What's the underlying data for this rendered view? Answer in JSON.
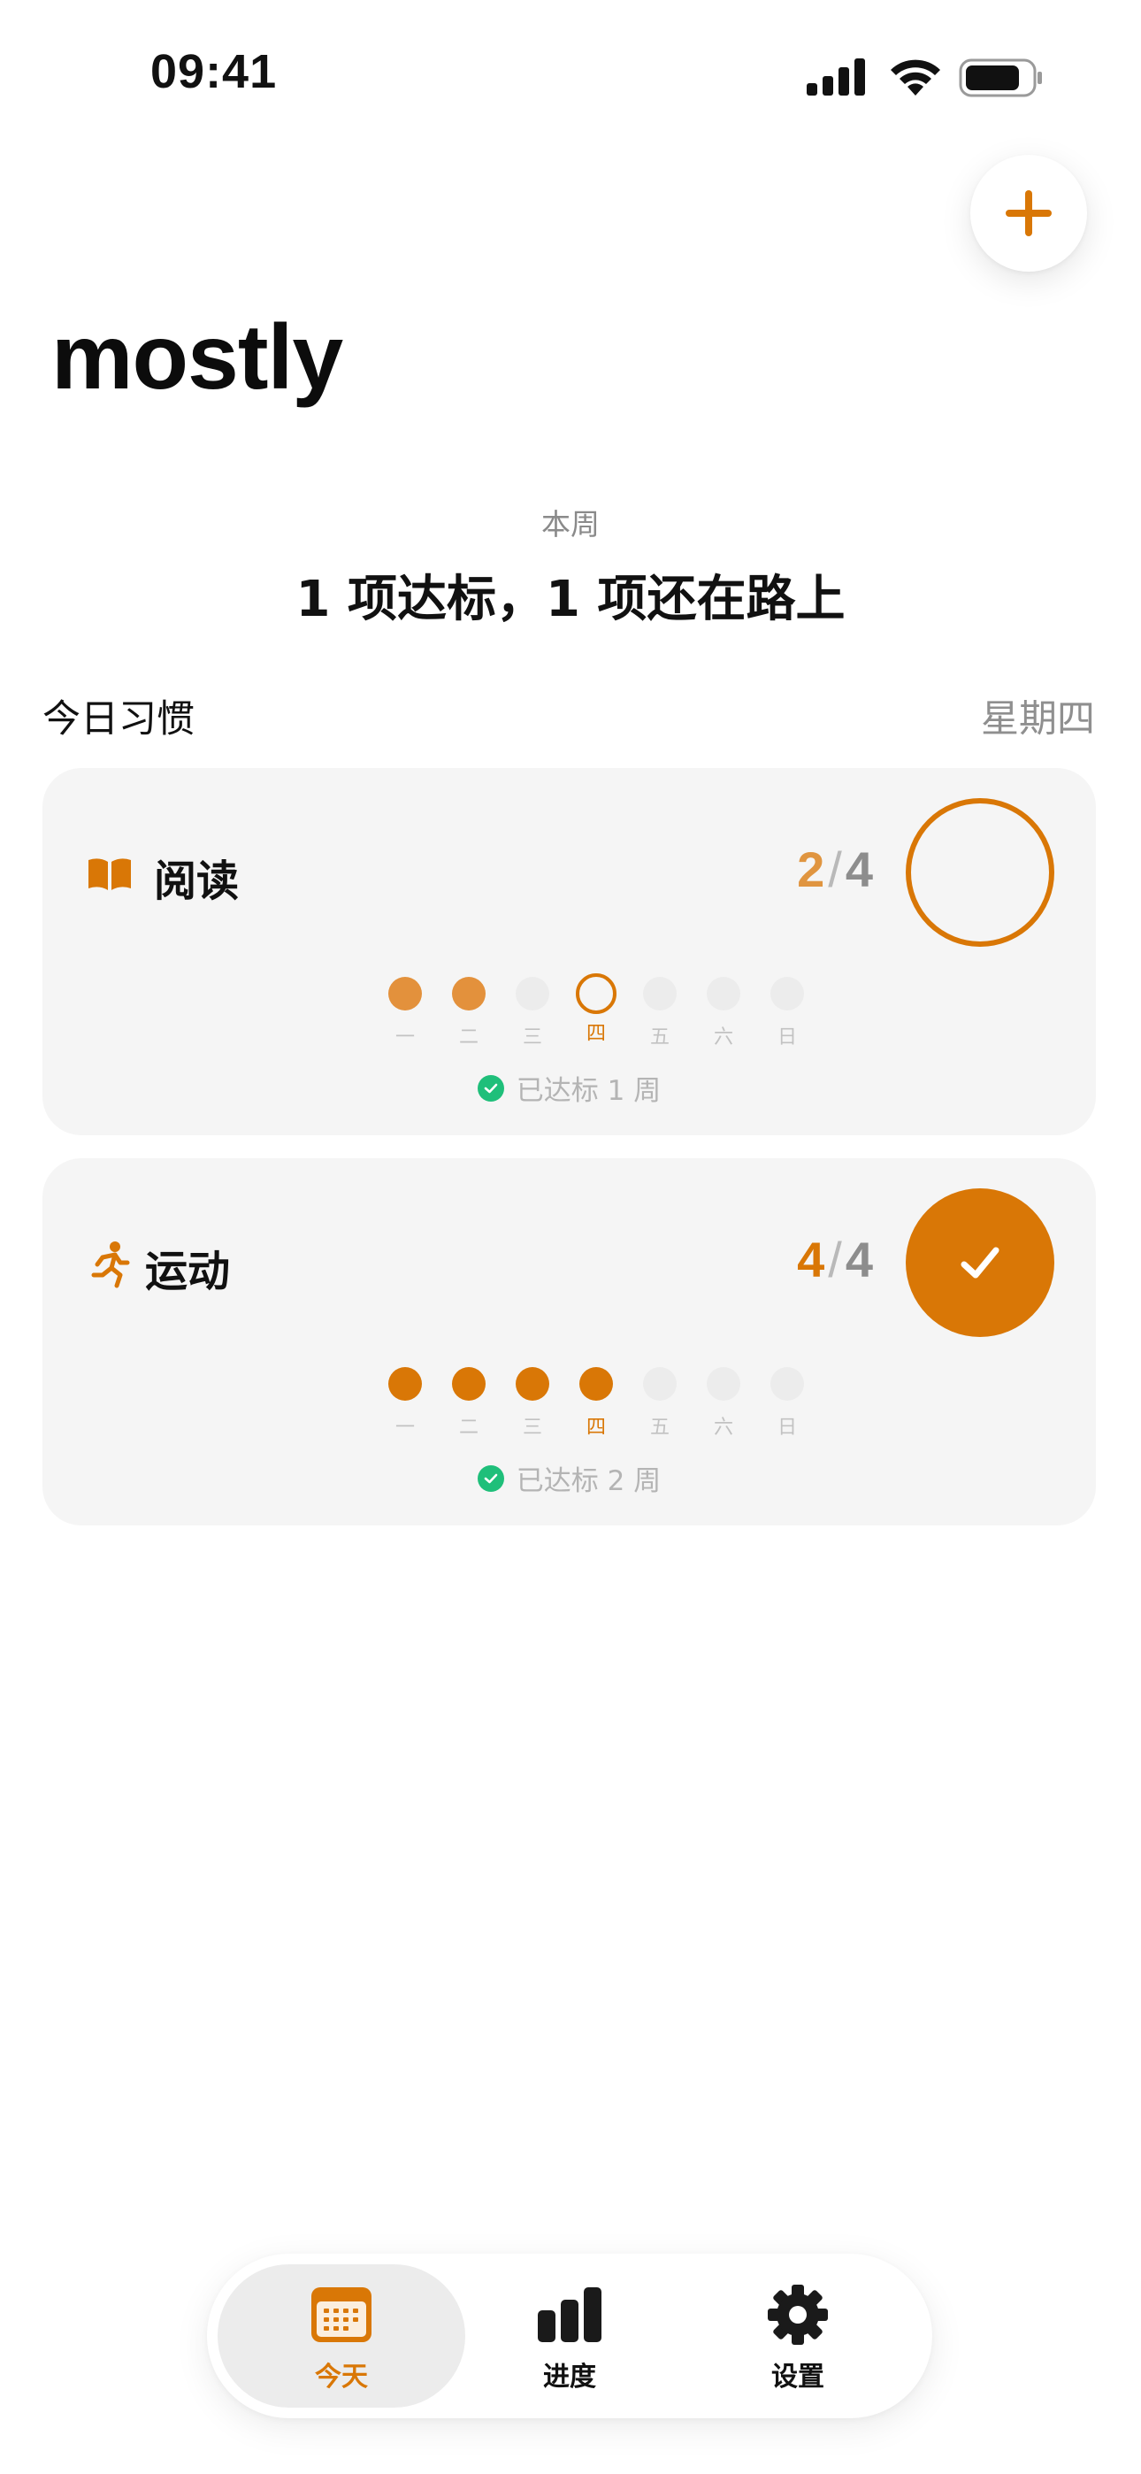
{
  "status_bar": {
    "time": "09:41"
  },
  "header": {
    "app_title": "mostly",
    "add_icon": "plus-icon"
  },
  "summary": {
    "label": "本周",
    "text": "1 项达标，1 项还在路上"
  },
  "today_section": {
    "title": "今日习惯",
    "weekday": "星期四"
  },
  "weekday_labels": [
    "一",
    "二",
    "三",
    "四",
    "五",
    "六",
    "日"
  ],
  "habits": [
    {
      "name": "阅读",
      "icon": "book-icon",
      "done": "2",
      "separator": "/",
      "target": "4",
      "completed_today": false,
      "week_status": [
        "done",
        "done",
        "none",
        "today-pending",
        "none",
        "none",
        "none"
      ],
      "streak_text": "已达标 1 周"
    },
    {
      "name": "运动",
      "icon": "running-icon",
      "done": "4",
      "separator": "/",
      "target": "4",
      "completed_today": true,
      "week_status": [
        "done",
        "done",
        "done",
        "today-done",
        "none",
        "none",
        "none"
      ],
      "streak_text": "已达标 2 周"
    }
  ],
  "tabbar": {
    "items": [
      {
        "label": "今天",
        "icon": "calendar-icon",
        "active": true
      },
      {
        "label": "进度",
        "icon": "bar-chart-icon",
        "active": false
      },
      {
        "label": "设置",
        "icon": "gear-icon",
        "active": false
      }
    ]
  },
  "colors": {
    "accent": "#d97706",
    "accent_light": "#e3913c",
    "success": "#1fbf7a",
    "card_bg": "#f5f5f5"
  }
}
